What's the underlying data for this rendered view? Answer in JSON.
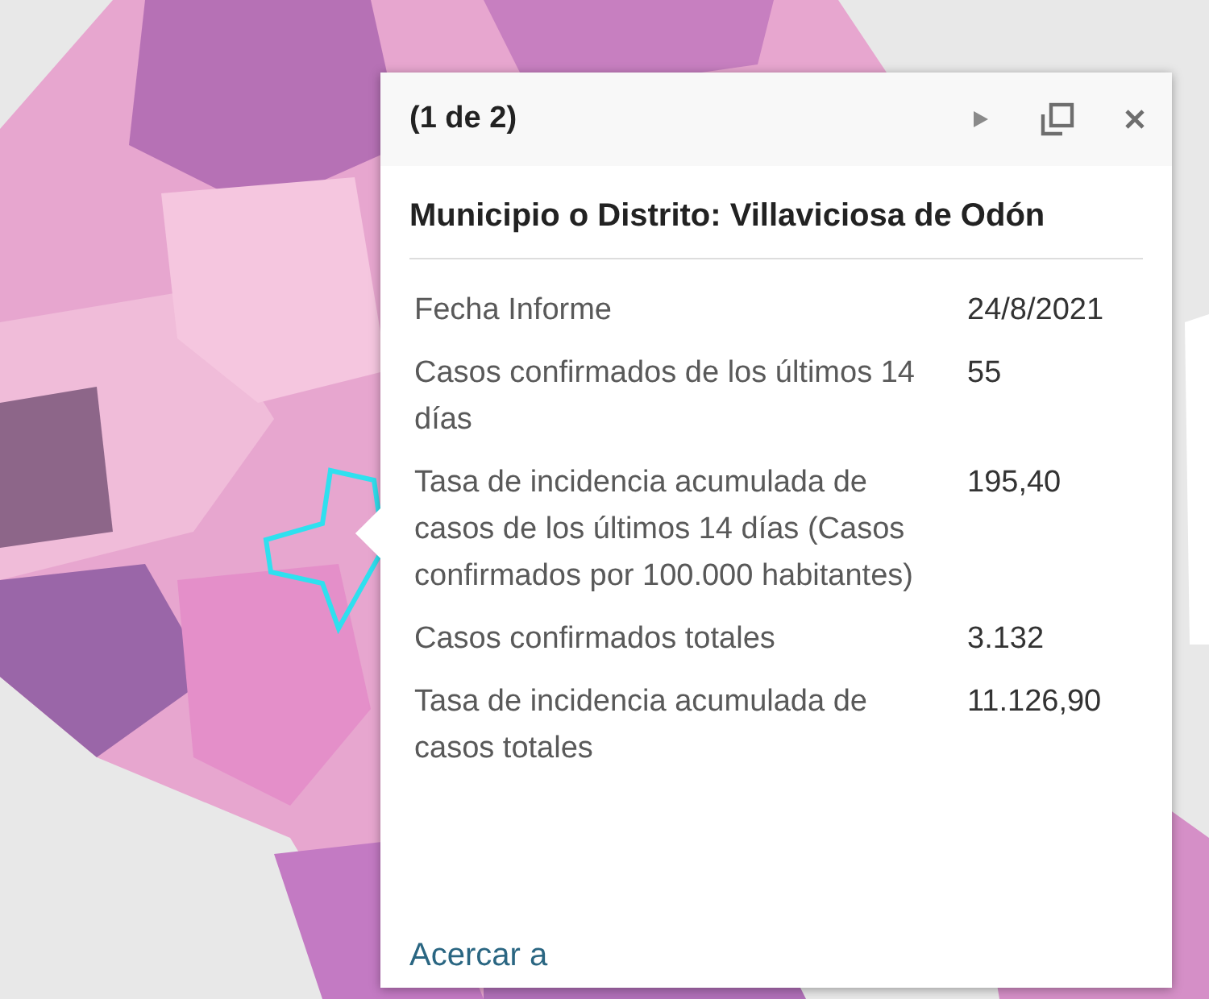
{
  "popup": {
    "title": "(1 de 2)",
    "heading": "Municipio o Distrito: Villaviciosa de Odón",
    "rows": [
      {
        "label": "Fecha Informe",
        "value": "24/8/2021"
      },
      {
        "label": "Casos confirmados de los últimos 14 días",
        "value": "55"
      },
      {
        "label": "Tasa de incidencia acumulada de casos de los últimos 14 días (Casos confirmados por 100.000 habitantes)",
        "value": "195,40"
      },
      {
        "label": "Casos confirmados totales",
        "value": "3.132"
      },
      {
        "label": "Tasa de incidencia acumulada de casos totales",
        "value": "11.126,90"
      }
    ],
    "link": "Acercar a"
  }
}
